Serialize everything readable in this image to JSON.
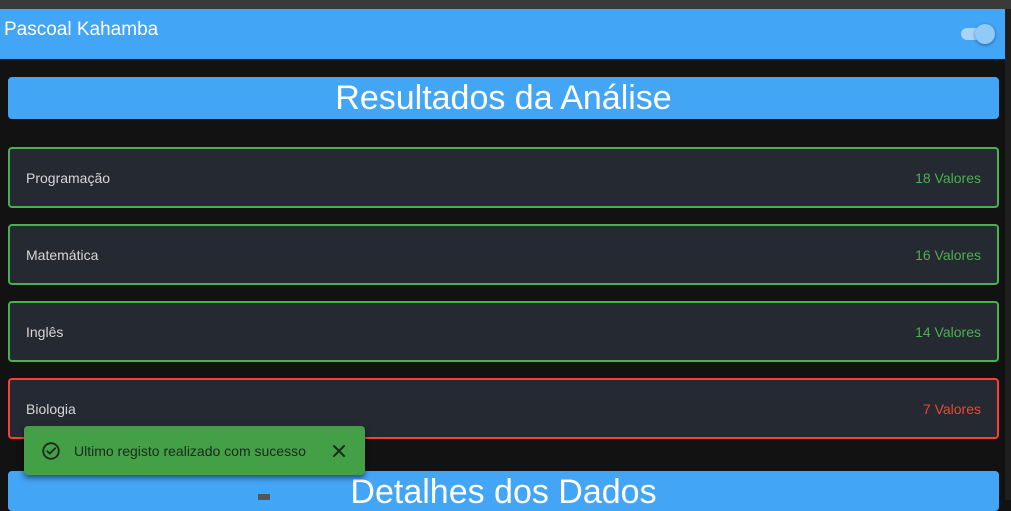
{
  "appbar": {
    "title": "Pascoal Kahamba",
    "theme_toggle_on": true
  },
  "results_section": {
    "title": "Resultados da Análise",
    "items": [
      {
        "subject": "Programação",
        "grade": "18 Valores",
        "status": "pass"
      },
      {
        "subject": "Matemática",
        "grade": "16 Valores",
        "status": "pass"
      },
      {
        "subject": "Inglês",
        "grade": "14 Valores",
        "status": "pass"
      },
      {
        "subject": "Biologia",
        "grade": "7 Valores",
        "status": "fail"
      }
    ]
  },
  "details_section": {
    "title": "Detalhes dos Dados"
  },
  "toast": {
    "message": "Ultimo registo realizado com sucesso",
    "icon": "check-circle-icon",
    "close_icon": "close-icon"
  },
  "colors": {
    "primary": "#42a5f5",
    "pass": "#4caf50",
    "fail": "#f44336",
    "card_bg": "#252932",
    "page_bg": "#121212",
    "toast_bg": "#43a047"
  }
}
